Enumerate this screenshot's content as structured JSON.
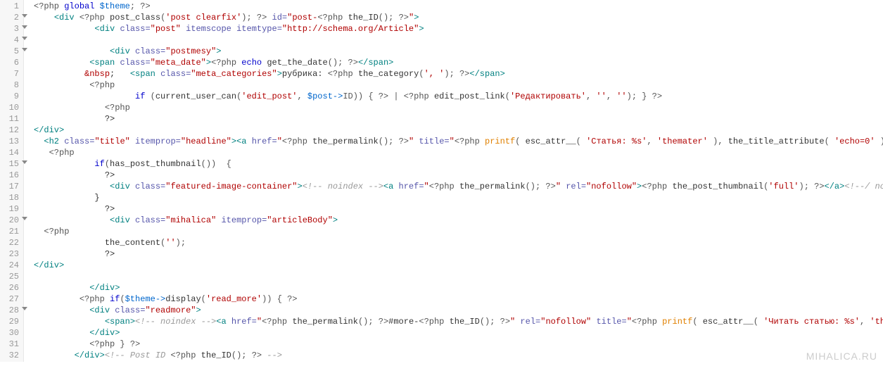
{
  "watermark": "MIHALICA.RU",
  "lines": [
    {
      "n": 1,
      "fold": false,
      "tokens": [
        [
          "php",
          "<?php "
        ],
        [
          "kw",
          "global "
        ],
        [
          "var",
          "$theme"
        ],
        [
          "php",
          "; ?>"
        ]
      ]
    },
    {
      "n": 2,
      "fold": true,
      "tokens": [
        [
          "txt",
          "    "
        ],
        [
          "tag",
          "<div "
        ],
        [
          "php",
          "<?php "
        ],
        [
          "fn",
          "post_class"
        ],
        [
          "php",
          "("
        ],
        [
          "str",
          "'post clearfix'"
        ],
        [
          "php",
          "); ?>"
        ],
        [
          "attr",
          " id="
        ],
        [
          "str",
          "\"post-"
        ],
        [
          "php",
          "<?php "
        ],
        [
          "fn",
          "the_ID"
        ],
        [
          "php",
          "(); ?>"
        ],
        [
          "str",
          "\""
        ],
        [
          "tag",
          ">"
        ]
      ]
    },
    {
      "n": 3,
      "fold": true,
      "tokens": [
        [
          "txt",
          "            "
        ],
        [
          "tag",
          "<div "
        ],
        [
          "attr",
          "class="
        ],
        [
          "str",
          "\"post\""
        ],
        [
          "attr",
          " itemscope itemtype="
        ],
        [
          "str",
          "\"http://schema.org/Article\""
        ],
        [
          "tag",
          ">"
        ]
      ]
    },
    {
      "n": 4,
      "fold": true,
      "tokens": [
        [
          "txt",
          " "
        ]
      ]
    },
    {
      "n": 5,
      "fold": true,
      "tokens": [
        [
          "txt",
          "               "
        ],
        [
          "tag",
          "<div "
        ],
        [
          "attr",
          "class="
        ],
        [
          "str",
          "\"postmesy\""
        ],
        [
          "tag",
          ">"
        ]
      ]
    },
    {
      "n": 6,
      "fold": false,
      "tokens": [
        [
          "txt",
          "           "
        ],
        [
          "tag",
          "<span "
        ],
        [
          "attr",
          "class="
        ],
        [
          "str",
          "\"meta_date\""
        ],
        [
          "tag",
          ">"
        ],
        [
          "php",
          "<?php "
        ],
        [
          "kw",
          "echo "
        ],
        [
          "fn",
          "get_the_date"
        ],
        [
          "php",
          "(); ?>"
        ],
        [
          "tag",
          "</span>"
        ]
      ]
    },
    {
      "n": 7,
      "fold": false,
      "tokens": [
        [
          "txt",
          "          "
        ],
        [
          "ent",
          "&nbsp"
        ],
        [
          "txt",
          ";   "
        ],
        [
          "tag",
          "<span "
        ],
        [
          "attr",
          "class="
        ],
        [
          "str",
          "\"meta_categories\""
        ],
        [
          "tag",
          ">"
        ],
        [
          "txt",
          "рубрика: "
        ],
        [
          "php",
          "<?php "
        ],
        [
          "fn",
          "the_category"
        ],
        [
          "php",
          "("
        ],
        [
          "str",
          "', '"
        ],
        [
          "php",
          "); ?>"
        ],
        [
          "tag",
          "</span>"
        ]
      ]
    },
    {
      "n": 8,
      "fold": false,
      "tokens": [
        [
          "txt",
          "           "
        ],
        [
          "php",
          "<?php"
        ]
      ]
    },
    {
      "n": 9,
      "fold": false,
      "tokens": [
        [
          "txt",
          "                    "
        ],
        [
          "kw",
          "if "
        ],
        [
          "php",
          "("
        ],
        [
          "fn",
          "current_user_can"
        ],
        [
          "php",
          "("
        ],
        [
          "str",
          "'edit_post'"
        ],
        [
          "php",
          ", "
        ],
        [
          "var",
          "$post->"
        ],
        [
          "php",
          "ID)) { ?> | <?php "
        ],
        [
          "fn",
          "edit_post_link"
        ],
        [
          "php",
          "("
        ],
        [
          "str",
          "'Редактировать'"
        ],
        [
          "php",
          ", "
        ],
        [
          "str",
          "''"
        ],
        [
          "php",
          ", "
        ],
        [
          "str",
          "''"
        ],
        [
          "php",
          "); } ?>"
        ]
      ]
    },
    {
      "n": 10,
      "fold": false,
      "tokens": [
        [
          "txt",
          "              "
        ],
        [
          "php",
          "<?php"
        ]
      ]
    },
    {
      "n": 11,
      "fold": false,
      "tokens": [
        [
          "txt",
          "              ?>"
        ]
      ]
    },
    {
      "n": 12,
      "fold": false,
      "tokens": [
        [
          "tag",
          "</div>"
        ]
      ]
    },
    {
      "n": 13,
      "fold": false,
      "tokens": [
        [
          "txt",
          "  "
        ],
        [
          "tag",
          "<h2 "
        ],
        [
          "attr",
          "class="
        ],
        [
          "str",
          "\"title\""
        ],
        [
          "attr",
          " itemprop="
        ],
        [
          "str",
          "\"headline\""
        ],
        [
          "tag",
          "><a "
        ],
        [
          "attr",
          "href="
        ],
        [
          "str",
          "\""
        ],
        [
          "php",
          "<?php "
        ],
        [
          "fn",
          "the_permalink"
        ],
        [
          "php",
          "(); ?>"
        ],
        [
          "str",
          "\""
        ],
        [
          "attr",
          " title="
        ],
        [
          "str",
          "\""
        ],
        [
          "php",
          "<?php "
        ],
        [
          "hl",
          "printf"
        ],
        [
          "php",
          "( "
        ],
        [
          "fn",
          "esc_attr__"
        ],
        [
          "php",
          "( "
        ],
        [
          "str",
          "'Статья: %s'"
        ],
        [
          "php",
          ", "
        ],
        [
          "str",
          "'themater'"
        ],
        [
          "php",
          " ), "
        ],
        [
          "fn",
          "the_title_attribute"
        ],
        [
          "php",
          "( "
        ],
        [
          "str",
          "'echo=0'"
        ],
        [
          "php",
          " ) ); ?>"
        ]
      ]
    },
    {
      "n": 14,
      "fold": false,
      "tokens": [
        [
          "txt",
          "   "
        ],
        [
          "php",
          "<?php"
        ]
      ]
    },
    {
      "n": 15,
      "fold": true,
      "tokens": [
        [
          "txt",
          "            "
        ],
        [
          "kw",
          "if"
        ],
        [
          "php",
          "("
        ],
        [
          "fn",
          "has_post_thumbnail"
        ],
        [
          "php",
          "())  {"
        ]
      ]
    },
    {
      "n": 16,
      "fold": false,
      "tokens": [
        [
          "txt",
          "              ?>"
        ]
      ]
    },
    {
      "n": 17,
      "fold": false,
      "tokens": [
        [
          "txt",
          "               "
        ],
        [
          "tag",
          "<div "
        ],
        [
          "attr",
          "class="
        ],
        [
          "str",
          "\"featured-image-container\""
        ],
        [
          "tag",
          ">"
        ],
        [
          "com",
          "<!-- noindex -->"
        ],
        [
          "tag",
          "<a "
        ],
        [
          "attr",
          "href="
        ],
        [
          "str",
          "\""
        ],
        [
          "php",
          "<?php "
        ],
        [
          "fn",
          "the_permalink"
        ],
        [
          "php",
          "(); ?>"
        ],
        [
          "str",
          "\""
        ],
        [
          "attr",
          " rel="
        ],
        [
          "str",
          "\"nofollow\""
        ],
        [
          "tag",
          ">"
        ],
        [
          "php",
          "<?php "
        ],
        [
          "fn",
          "the_post_thumbnail"
        ],
        [
          "php",
          "("
        ],
        [
          "str",
          "'full'"
        ],
        [
          "php",
          "); ?>"
        ],
        [
          "tag",
          "</a>"
        ],
        [
          "com",
          "<!--/ noindex"
        ]
      ]
    },
    {
      "n": 18,
      "fold": false,
      "tokens": [
        [
          "txt",
          "            }"
        ]
      ]
    },
    {
      "n": 19,
      "fold": false,
      "tokens": [
        [
          "txt",
          "              ?>"
        ]
      ]
    },
    {
      "n": 20,
      "fold": true,
      "tokens": [
        [
          "txt",
          "               "
        ],
        [
          "tag",
          "<div "
        ],
        [
          "attr",
          "class="
        ],
        [
          "str",
          "\"mihalica\""
        ],
        [
          "attr",
          " itemprop="
        ],
        [
          "str",
          "\"articleBody\""
        ],
        [
          "tag",
          ">"
        ]
      ]
    },
    {
      "n": 21,
      "fold": false,
      "tokens": [
        [
          "txt",
          "  "
        ],
        [
          "php",
          "<?php"
        ]
      ]
    },
    {
      "n": 22,
      "fold": false,
      "tokens": [
        [
          "txt",
          "              "
        ],
        [
          "fn",
          "the_content"
        ],
        [
          "php",
          "("
        ],
        [
          "str",
          "''"
        ],
        [
          "php",
          ");"
        ]
      ]
    },
    {
      "n": 23,
      "fold": false,
      "tokens": [
        [
          "txt",
          "              ?>"
        ]
      ]
    },
    {
      "n": 24,
      "fold": false,
      "tokens": [
        [
          "tag",
          "</div>"
        ]
      ]
    },
    {
      "n": 25,
      "fold": false,
      "tokens": [
        [
          "txt",
          " "
        ]
      ]
    },
    {
      "n": 26,
      "fold": false,
      "tokens": [
        [
          "txt",
          "           "
        ],
        [
          "tag",
          "</div>"
        ]
      ]
    },
    {
      "n": 27,
      "fold": false,
      "tokens": [
        [
          "txt",
          "         "
        ],
        [
          "php",
          "<?php "
        ],
        [
          "kw",
          "if"
        ],
        [
          "php",
          "("
        ],
        [
          "var",
          "$theme->"
        ],
        [
          "fn",
          "display"
        ],
        [
          "php",
          "("
        ],
        [
          "str",
          "'read_more'"
        ],
        [
          "php",
          ")) { ?>"
        ]
      ]
    },
    {
      "n": 28,
      "fold": true,
      "tokens": [
        [
          "txt",
          "           "
        ],
        [
          "tag",
          "<div "
        ],
        [
          "attr",
          "class="
        ],
        [
          "str",
          "\"readmore\""
        ],
        [
          "tag",
          ">"
        ]
      ]
    },
    {
      "n": 29,
      "fold": false,
      "tokens": [
        [
          "txt",
          "              "
        ],
        [
          "tag",
          "<span>"
        ],
        [
          "com",
          "<!-- noindex -->"
        ],
        [
          "tag",
          "<a "
        ],
        [
          "attr",
          "href="
        ],
        [
          "str",
          "\""
        ],
        [
          "php",
          "<?php "
        ],
        [
          "fn",
          "the_permalink"
        ],
        [
          "php",
          "(); ?>"
        ],
        [
          "txt",
          "#more-"
        ],
        [
          "php",
          "<?php "
        ],
        [
          "fn",
          "the_ID"
        ],
        [
          "php",
          "(); ?>"
        ],
        [
          "str",
          "\""
        ],
        [
          "attr",
          " rel="
        ],
        [
          "str",
          "\"nofollow\""
        ],
        [
          "attr",
          " title="
        ],
        [
          "str",
          "\""
        ],
        [
          "php",
          "<?php "
        ],
        [
          "hl",
          "printf"
        ],
        [
          "php",
          "( "
        ],
        [
          "fn",
          "esc_attr__"
        ],
        [
          "php",
          "( "
        ],
        [
          "str",
          "'Читать статью: %s'"
        ],
        [
          "php",
          ", "
        ],
        [
          "str",
          "'themater'"
        ]
      ]
    },
    {
      "n": 30,
      "fold": false,
      "tokens": [
        [
          "txt",
          "           "
        ],
        [
          "tag",
          "</div>"
        ]
      ]
    },
    {
      "n": 31,
      "fold": false,
      "tokens": [
        [
          "txt",
          "           "
        ],
        [
          "php",
          "<?php } ?>"
        ]
      ]
    },
    {
      "n": 32,
      "fold": false,
      "tokens": [
        [
          "txt",
          "        "
        ],
        [
          "tag",
          "</div>"
        ],
        [
          "com",
          "<!-- Post ID "
        ],
        [
          "php",
          "<?php "
        ],
        [
          "fn",
          "the_ID"
        ],
        [
          "php",
          "(); ?>"
        ],
        [
          "com",
          " -->"
        ]
      ]
    }
  ]
}
